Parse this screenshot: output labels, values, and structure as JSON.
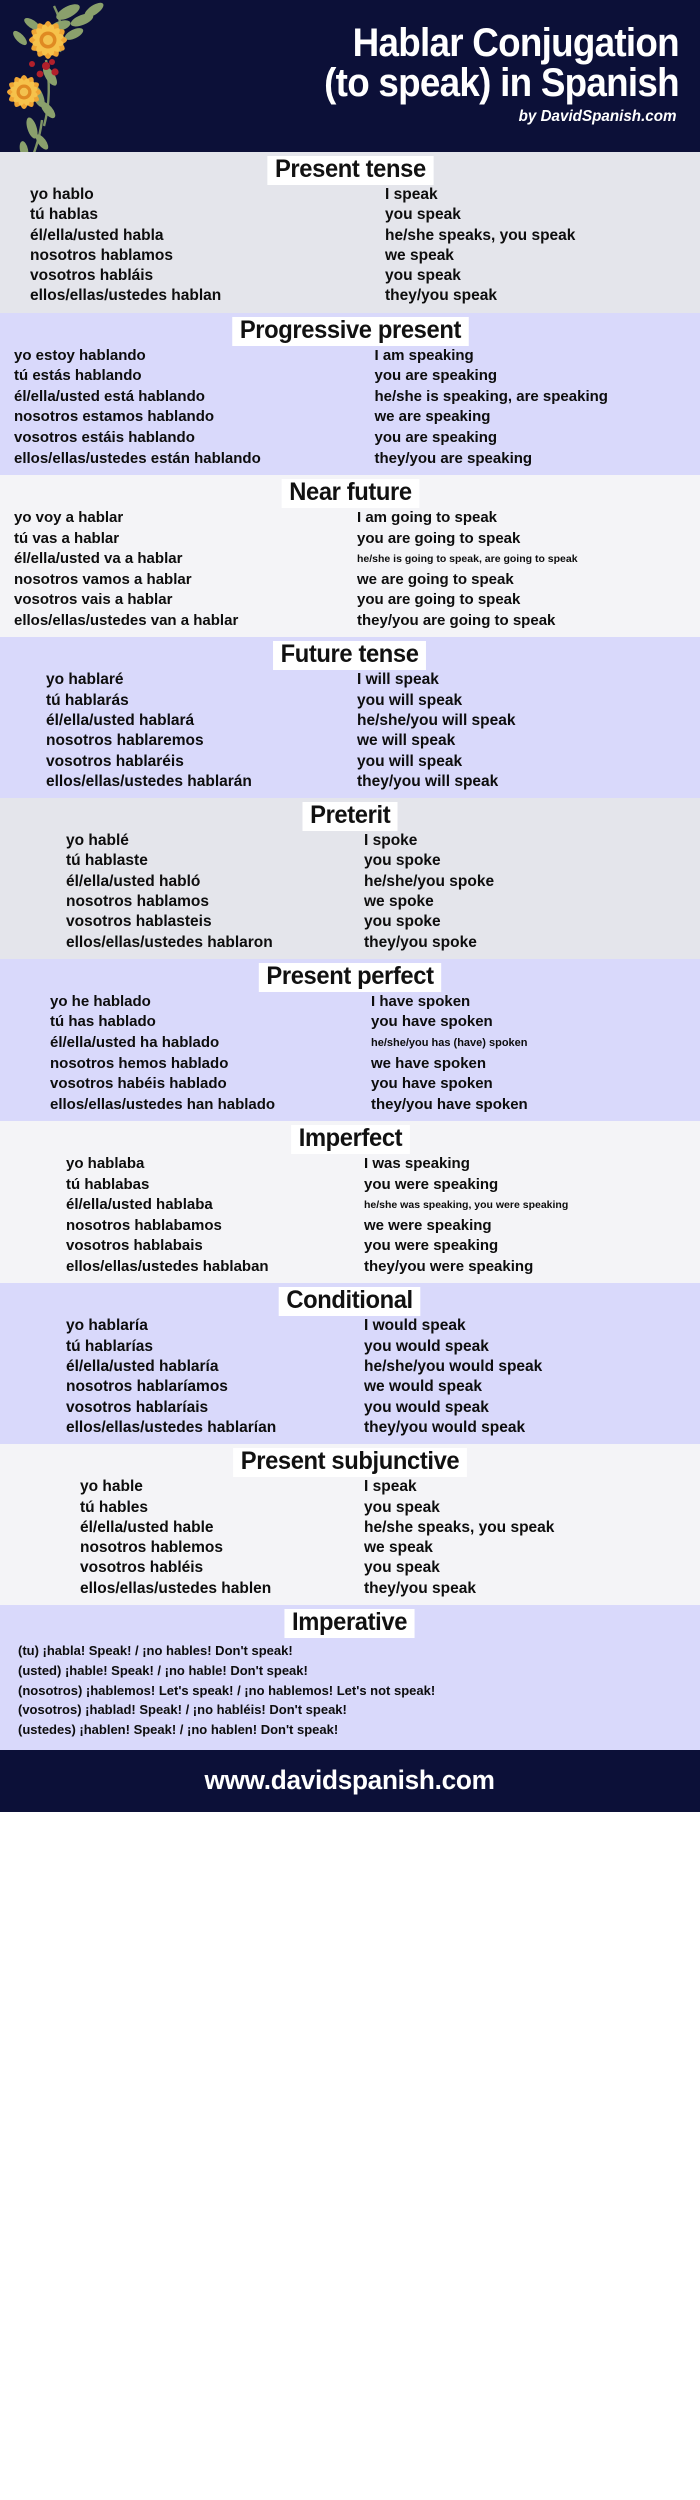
{
  "header": {
    "title_line1": "Hablar Conjugation",
    "title_line2": "(to speak) in Spanish",
    "byline": "by DavidSpanish.com",
    "icon": "floral-sunflower-ornament",
    "bg_color": "#0c1038",
    "text_color": "#ffffff"
  },
  "colors": {
    "dark_navy": "#0c1038",
    "lavender": "#d9d9fb",
    "light_gray": "#e4e5eb",
    "near_white": "#f4f4f7",
    "title_chip": "#ffffff",
    "body_text": "#0d0d0d"
  },
  "sections": [
    {
      "title": "Present tense",
      "bg": "light_gray",
      "rows": [
        {
          "es": "yo hablo",
          "en": "I speak",
          "small": false
        },
        {
          "es": "tú hablas",
          "en": "you speak",
          "small": false
        },
        {
          "es": "él/ella/usted habla",
          "en": "he/she speaks, you speak",
          "small": false
        },
        {
          "es": "nosotros hablamos",
          "en": "we speak",
          "small": false
        },
        {
          "es": "vosotros habláis",
          "en": "you speak",
          "small": false
        },
        {
          "es": "ellos/ellas/ustedes hablan",
          "en": "they/you speak",
          "small": false
        }
      ]
    },
    {
      "title": "Progressive present",
      "bg": "lavender",
      "rows": [
        {
          "es": "yo estoy hablando",
          "en": "I am speaking",
          "small": false
        },
        {
          "es": "tú estás hablando",
          "en": "you are speaking",
          "small": false
        },
        {
          "es": "él/ella/usted está hablando",
          "en": "he/she is speaking, are speaking",
          "small": true
        },
        {
          "es": "nosotros estamos hablando",
          "en": "we are speaking",
          "small": false
        },
        {
          "es": "vosotros estáis hablando",
          "en": "you are speaking",
          "small": false
        },
        {
          "es": "ellos/ellas/ustedes están hablando",
          "en": "they/you are speaking",
          "small": false
        }
      ]
    },
    {
      "title": "Near future",
      "bg": "near_white",
      "rows": [
        {
          "es": "yo voy a hablar",
          "en": "I am going to speak",
          "small": false
        },
        {
          "es": "tú vas a hablar",
          "en": "you are going to speak",
          "small": false
        },
        {
          "es": "él/ella/usted va a hablar",
          "en": "he/she is going to speak, are going to speak",
          "small": true
        },
        {
          "es": "nosotros vamos a hablar",
          "en": "we are going to speak",
          "small": false
        },
        {
          "es": "vosotros vais a hablar",
          "en": "you are going to speak",
          "small": false
        },
        {
          "es": "ellos/ellas/ustedes van a hablar",
          "en": "they/you are going to speak",
          "small": false
        }
      ]
    },
    {
      "title": "Future tense",
      "bg": "lavender",
      "rows": [
        {
          "es": "yo hablaré",
          "en": "I will speak",
          "small": false
        },
        {
          "es": "tú hablarás",
          "en": "you will speak",
          "small": false
        },
        {
          "es": "él/ella/usted hablará",
          "en": "he/she/you will speak",
          "small": false
        },
        {
          "es": "nosotros hablaremos",
          "en": "we will speak",
          "small": false
        },
        {
          "es": "vosotros hablaréis",
          "en": "you will speak",
          "small": false
        },
        {
          "es": "ellos/ellas/ustedes hablarán",
          "en": "they/you will speak",
          "small": false
        }
      ]
    },
    {
      "title": "Preterit",
      "bg": "light_gray",
      "rows": [
        {
          "es": "yo hablé",
          "en": "I spoke",
          "small": false
        },
        {
          "es": "tú hablaste",
          "en": "you spoke",
          "small": false
        },
        {
          "es": "él/ella/usted habló",
          "en": "he/she/you spoke",
          "small": false
        },
        {
          "es": "nosotros hablamos",
          "en": "we spoke",
          "small": false
        },
        {
          "es": "vosotros hablasteis",
          "en": "you spoke",
          "small": false
        },
        {
          "es": "ellos/ellas/ustedes hablaron",
          "en": "they/you spoke",
          "small": false
        }
      ]
    },
    {
      "title": "Present perfect",
      "bg": "lavender",
      "rows": [
        {
          "es": "yo he hablado",
          "en": "I have spoken",
          "small": false
        },
        {
          "es": "tú has hablado",
          "en": "you have spoken",
          "small": false
        },
        {
          "es": "él/ella/usted ha hablado",
          "en": "he/she/you has (have) spoken",
          "small": true
        },
        {
          "es": "nosotros hemos hablado",
          "en": "we have spoken",
          "small": false
        },
        {
          "es": "vosotros habéis hablado",
          "en": "you have spoken",
          "small": false
        },
        {
          "es": "ellos/ellas/ustedes han hablado",
          "en": "they/you have spoken",
          "small": false
        }
      ]
    },
    {
      "title": "Imperfect",
      "bg": "near_white",
      "rows": [
        {
          "es": "yo hablaba",
          "en": "I was speaking",
          "small": false
        },
        {
          "es": "tú hablabas",
          "en": "you were speaking",
          "small": false
        },
        {
          "es": "él/ella/usted hablaba",
          "en": "he/she was speaking, you were speaking",
          "small": true
        },
        {
          "es": "nosotros hablabamos",
          "en": "we were speaking",
          "small": false
        },
        {
          "es": "vosotros hablabais",
          "en": "you were speaking",
          "small": false
        },
        {
          "es": "ellos/ellas/ustedes hablaban",
          "en": "they/you were speaking",
          "small": false
        }
      ]
    },
    {
      "title": "Conditional",
      "bg": "lavender",
      "rows": [
        {
          "es": "yo hablaría",
          "en": "I would speak",
          "small": false
        },
        {
          "es": "tú hablarías",
          "en": "you would speak",
          "small": false
        },
        {
          "es": "él/ella/usted hablaría",
          "en": "he/she/you would speak",
          "small": false
        },
        {
          "es": "nosotros hablaríamos",
          "en": "we would speak",
          "small": false
        },
        {
          "es": "vosotros hablaríais",
          "en": "you would speak",
          "small": false
        },
        {
          "es": "ellos/ellas/ustedes hablarían",
          "en": "they/you would speak",
          "small": false
        }
      ]
    },
    {
      "title": "Present subjunctive",
      "bg": "near_white",
      "rows": [
        {
          "es": "yo hable",
          "en": "I speak",
          "small": false
        },
        {
          "es": "tú hables",
          "en": "you speak",
          "small": false
        },
        {
          "es": "él/ella/usted hable",
          "en": "he/she speaks, you speak",
          "small": false
        },
        {
          "es": "nosotros hablemos",
          "en": "we speak",
          "small": false
        },
        {
          "es": "vosotros habléis",
          "en": "you speak",
          "small": false
        },
        {
          "es": "ellos/ellas/ustedes hablen",
          "en": "they/you speak",
          "small": false
        }
      ]
    }
  ],
  "imperative": {
    "title": "Imperative",
    "bg": "lavender",
    "lines": [
      "(tu) ¡habla! Speak! / ¡no hables! Don't speak!",
      "(usted) ¡hable! Speak! / ¡no hable! Don't speak!",
      "(nosotros)  ¡hablemos! Let's speak! / ¡no hablemos! Let's not speak!",
      "(vosotros) ¡hablad! Speak! / ¡no habléis! Don't speak!",
      "(ustedes) ¡hablen! Speak! / ¡no hablen! Don't speak!"
    ]
  },
  "footer": {
    "url": "www.davidspanish.com",
    "bg_color": "#0c1038",
    "text_color": "#ffffff"
  }
}
